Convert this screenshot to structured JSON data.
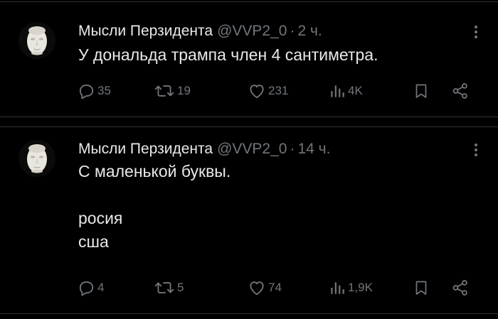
{
  "tweets": [
    {
      "author_name": "Мысли Перзидента",
      "handle": "@VVP2_0",
      "separator": "·",
      "time": "2 ч.",
      "text": "У дональда трампа член 4 сантиметра.",
      "replies": "35",
      "retweets": "19",
      "likes": "231",
      "views": "4K"
    },
    {
      "author_name": "Мысли Перзидента",
      "handle": "@VVP2_0",
      "separator": "·",
      "time": "14 ч.",
      "text": "С маленькой буквы.\n\nросия\nсша",
      "replies": "4",
      "retweets": "5",
      "likes": "74",
      "views": "1,9K"
    }
  ],
  "icons": {
    "avatar": "face-mask-avatar",
    "more": "more-vertical-icon",
    "reply": "reply-icon",
    "retweet": "retweet-icon",
    "like": "heart-icon",
    "views": "views-icon",
    "bookmark": "bookmark-icon",
    "share": "share-icon"
  },
  "colors": {
    "background": "#000000",
    "text": "#e7e9ea",
    "muted": "#71767b",
    "divider": "#2f3336"
  }
}
